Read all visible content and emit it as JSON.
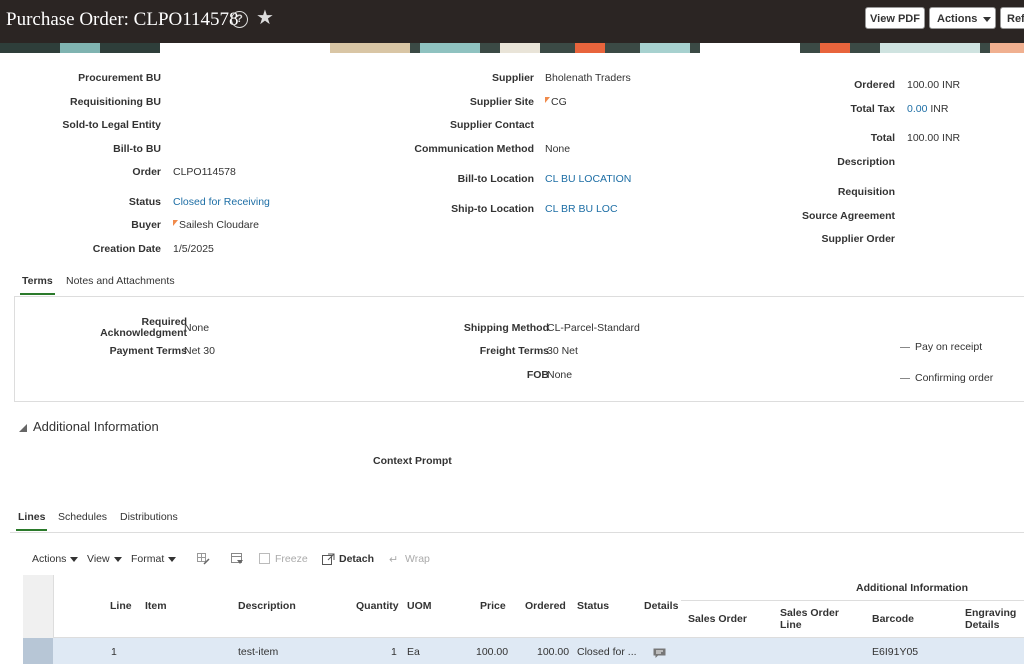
{
  "header": {
    "title": "Purchase Order: CLPO114578",
    "buttons": {
      "view_pdf": "View PDF",
      "actions": "Actions",
      "refresh": "Ref"
    }
  },
  "colors": {
    "header_bg": "#2b2523",
    "link": "#1d6ea5",
    "active_tab": "#2b7a2b",
    "selected_row": "#dfe9f4"
  },
  "summary": {
    "left": [
      {
        "label": "Procurement BU",
        "value": ""
      },
      {
        "label": "Requisitioning BU",
        "value": ""
      },
      {
        "label": "Sold-to Legal Entity",
        "value": ""
      },
      {
        "label": "Bill-to BU",
        "value": ""
      },
      {
        "label": "Order",
        "value": "CLPO114578"
      },
      {
        "label": "Status",
        "value": "Closed for Receiving"
      },
      {
        "label": "Buyer",
        "value": "Sailesh Cloudare"
      },
      {
        "label": "Creation Date",
        "value": "1/5/2025"
      }
    ],
    "middle": [
      {
        "label": "Supplier",
        "value": "Bholenath Traders"
      },
      {
        "label": "Supplier Site",
        "value": "CG"
      },
      {
        "label": "Supplier Contact",
        "value": ""
      },
      {
        "label": "Communication Method",
        "value": "None"
      },
      {
        "label": "Bill-to Location",
        "value": "CL BU LOCATION"
      },
      {
        "label": "Ship-to Location",
        "value": "CL BR BU LOC"
      }
    ],
    "right": [
      {
        "label": "Ordered",
        "value": "100.00",
        "unit": "INR"
      },
      {
        "label": "Total Tax",
        "value": "0.00",
        "unit": "INR"
      },
      {
        "label": "Total",
        "value": "100.00",
        "unit": "INR"
      },
      {
        "label": "Description",
        "value": ""
      },
      {
        "label": "Requisition",
        "value": ""
      },
      {
        "label": "Source Agreement",
        "value": ""
      },
      {
        "label": "Supplier Order",
        "value": ""
      }
    ]
  },
  "terms_tabs": [
    "Terms",
    "Notes and Attachments"
  ],
  "terms": {
    "required_ack_label": "Required Acknowledgment",
    "required_ack_value": "None",
    "payment_terms_label": "Payment Terms",
    "payment_terms_value": "Net 30",
    "shipping_method_label": "Shipping Method",
    "shipping_method_value": "CL-Parcel-Standard",
    "freight_terms_label": "Freight Terms",
    "freight_terms_value": "30 Net",
    "fob_label": "FOB",
    "fob_value": "None",
    "pay_on_receipt": "Pay on receipt",
    "confirming_order": "Confirming order"
  },
  "additional_info": {
    "title": "Additional Information",
    "context_prompt": "Context Prompt"
  },
  "lines_tabs": [
    "Lines",
    "Schedules",
    "Distributions"
  ],
  "toolbar": {
    "actions": "Actions",
    "view": "View",
    "format": "Format",
    "freeze": "Freeze",
    "detach": "Detach",
    "wrap": "Wrap"
  },
  "table": {
    "group_header": "Additional Information",
    "columns": {
      "line": "Line",
      "item": "Item",
      "description": "Description",
      "quantity": "Quantity",
      "uom": "UOM",
      "price": "Price",
      "ordered": "Ordered",
      "status": "Status",
      "details": "Details",
      "sales_order": "Sales Order",
      "sales_order_line": "Sales Order Line",
      "barcode": "Barcode",
      "engraving_details": "Engraving Details"
    },
    "rows": [
      {
        "line": "1",
        "item": "",
        "description": "test-item",
        "quantity": "1",
        "uom": "Ea",
        "price": "100.00",
        "ordered": "100.00",
        "status": "Closed for ...",
        "sales_order": "",
        "sales_order_line": "",
        "barcode": "E6I91Y05",
        "engraving_details": ""
      }
    ]
  }
}
